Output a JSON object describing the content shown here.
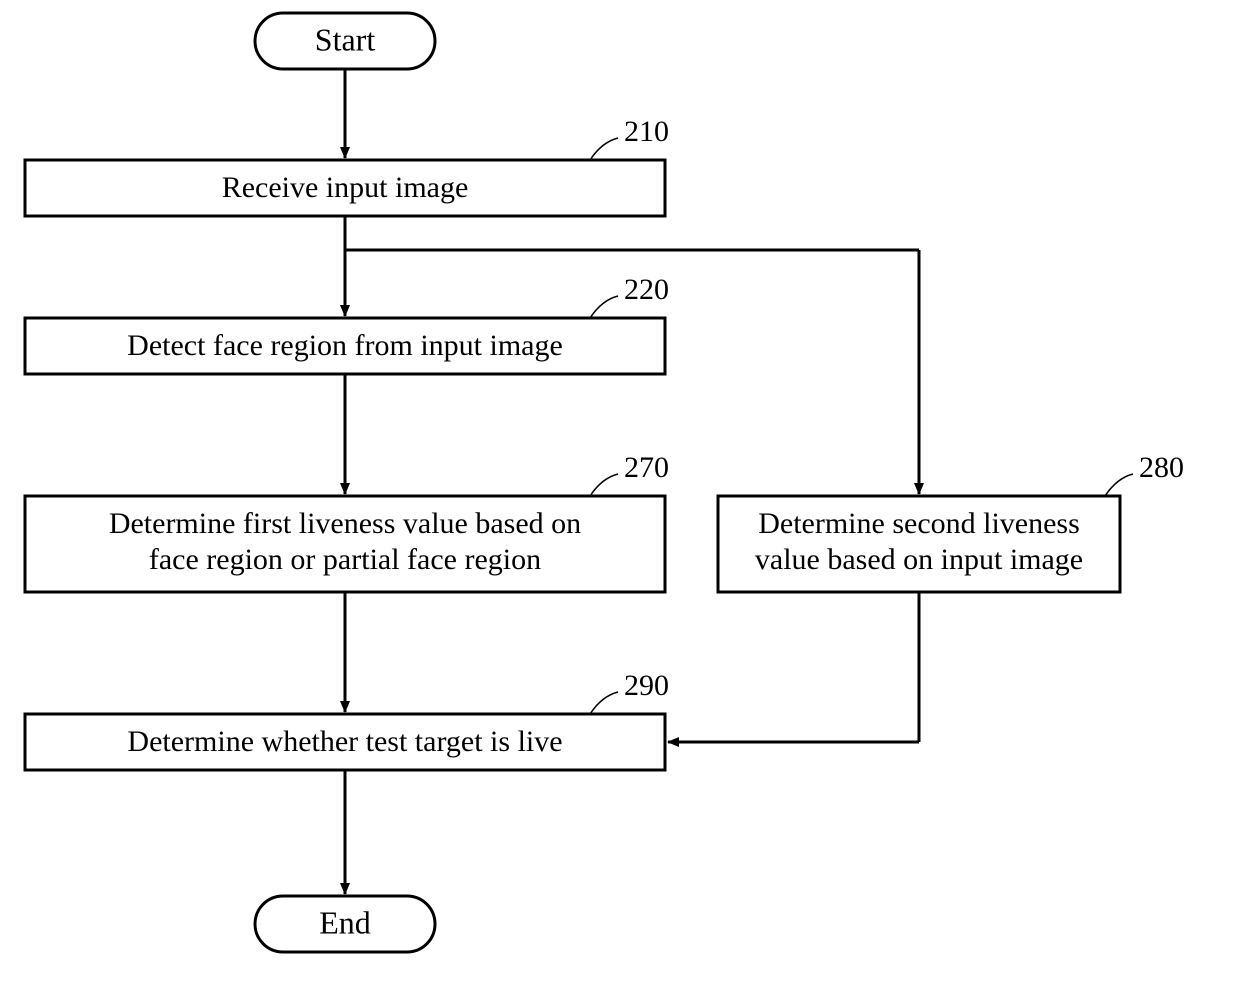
{
  "chart_data": {
    "type": "flowchart",
    "nodes": [
      {
        "id": "start",
        "kind": "terminator",
        "text": "Start"
      },
      {
        "id": "210",
        "kind": "process",
        "text": "Receive input image",
        "ref": "210"
      },
      {
        "id": "220",
        "kind": "process",
        "text": "Detect face region from input image",
        "ref": "220"
      },
      {
        "id": "270",
        "kind": "process",
        "text_line1": "Determine first liveness value based on",
        "text_line2": "face region or partial face region",
        "ref": "270"
      },
      {
        "id": "280",
        "kind": "process",
        "text_line1": "Determine second liveness",
        "text_line2": "value based on input image",
        "ref": "280"
      },
      {
        "id": "290",
        "kind": "process",
        "text": "Determine whether test target is live",
        "ref": "290"
      },
      {
        "id": "end",
        "kind": "terminator",
        "text": "End"
      }
    ],
    "edges": [
      {
        "from": "start",
        "to": "210"
      },
      {
        "from": "210",
        "to": "220"
      },
      {
        "from": "220",
        "to": "270"
      },
      {
        "from": "270",
        "to": "290"
      },
      {
        "from": "290",
        "to": "end"
      },
      {
        "from": "210",
        "to": "280"
      },
      {
        "from": "280",
        "to": "290"
      }
    ]
  },
  "terminators": {
    "start": "Start",
    "end": "End"
  },
  "steps": {
    "s210": {
      "ref": "210",
      "text": "Receive input image"
    },
    "s220": {
      "ref": "220",
      "text": "Detect face region from input image"
    },
    "s270": {
      "ref": "270",
      "line1": "Determine first liveness value based on",
      "line2": "face region or partial face region"
    },
    "s280": {
      "ref": "280",
      "line1": "Determine second liveness",
      "line2": "value based on input image"
    },
    "s290": {
      "ref": "290",
      "text": "Determine whether test target is live"
    }
  }
}
